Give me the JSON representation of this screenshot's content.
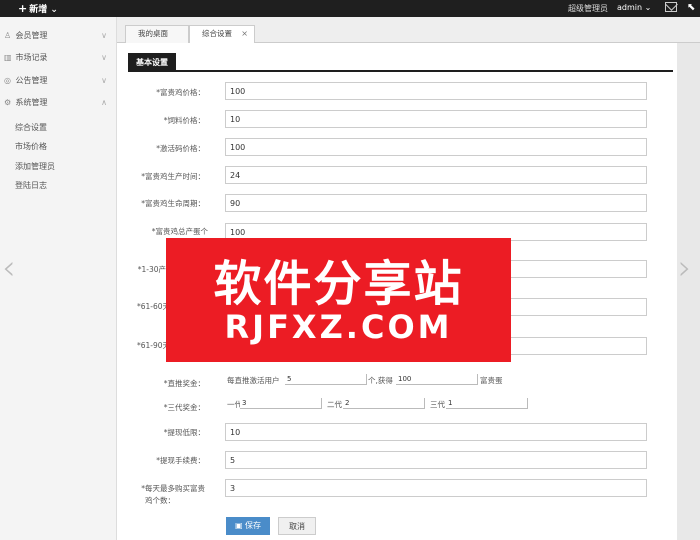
{
  "topbar": {
    "new_label": "新增",
    "role": "超级管理员",
    "user": "admin"
  },
  "sidebar": {
    "items": [
      {
        "label": "会员管理"
      },
      {
        "label": "市场记录"
      },
      {
        "label": "公告管理"
      },
      {
        "label": "系统管理"
      }
    ],
    "sub_items": [
      {
        "label": "综合设置"
      },
      {
        "label": "市场价格"
      },
      {
        "label": "添加管理员"
      },
      {
        "label": "登陆日志"
      }
    ]
  },
  "tabs": [
    {
      "label": "我的桌面"
    },
    {
      "label": "综合设置"
    }
  ],
  "panel": {
    "title": "基本设置"
  },
  "fields": [
    {
      "label": "*富贵鸡价格：",
      "value": "100"
    },
    {
      "label": "*饲料价格：",
      "value": "10"
    },
    {
      "label": "*激活码价格：",
      "value": "100"
    },
    {
      "label": "*富贵鸡生产时间：",
      "value": "24"
    },
    {
      "label": "*富贵鸡生命周期：",
      "value": "90"
    },
    {
      "label": "*富贵鸡总产蛋个",
      "value": "100"
    },
    {
      "label": "*1-30产",
      "value": ""
    },
    {
      "label": "*61-60天",
      "value": ""
    },
    {
      "label": "*61-90天",
      "value": ""
    }
  ],
  "direct_bonus": {
    "label": "*直推奖金：",
    "text1": "每直推激活用户",
    "val1": "5",
    "text2": "个,获得",
    "val2": "100",
    "text3": "富贵蛋"
  },
  "gen_bonus": {
    "label": "*三代奖金：",
    "gen1_label": "一代",
    "gen1_value": "3",
    "gen2_label": "二代",
    "gen2_value": "2",
    "gen3_label": "三代",
    "gen3_value": "1"
  },
  "fields2": [
    {
      "label": "*提现低限：",
      "value": "10"
    },
    {
      "label": "*提现手续费：",
      "value": "5"
    },
    {
      "label": "*每天最多购买富贵",
      "label2": "鸡个数：",
      "value": "3"
    }
  ],
  "buttons": {
    "save": "保存",
    "cancel": "取消"
  },
  "watermark": {
    "line1": "软件分享站",
    "line2": "RJFXZ.COM"
  },
  "colors": {
    "topbar": "#1f1f1f",
    "accent": "#4a8cc9",
    "watermark": "#ec1c24"
  }
}
